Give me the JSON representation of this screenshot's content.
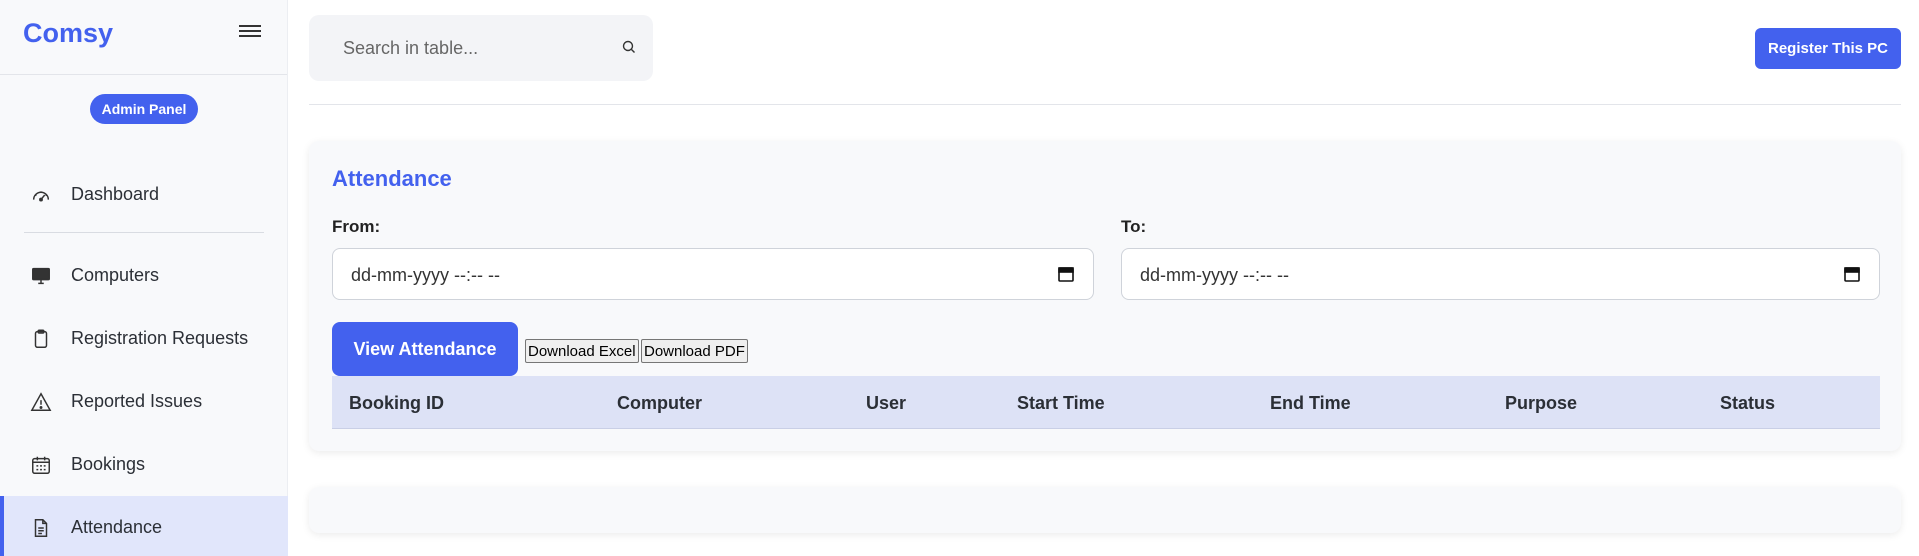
{
  "brand": {
    "title": "Comsy"
  },
  "sidebar": {
    "badge": "Admin Panel",
    "items": [
      {
        "label": "Dashboard",
        "icon": "gauge-icon"
      },
      {
        "label": "Computers",
        "icon": "monitor-icon"
      },
      {
        "label": "Registration Requests",
        "icon": "clipboard-icon"
      },
      {
        "label": "Reported Issues",
        "icon": "warning-triangle-icon"
      },
      {
        "label": "Bookings",
        "icon": "calendar-icon"
      },
      {
        "label": "Attendance",
        "icon": "document-icon",
        "active": true
      }
    ]
  },
  "search": {
    "placeholder": "Search in table..."
  },
  "header": {
    "register_label": "Register This PC"
  },
  "attendance": {
    "title": "Attendance",
    "from_label": "From:",
    "to_label": "To:",
    "from_value": "dd-mm-yyyy --:-- --",
    "to_value": "dd-mm-yyyy --:-- --",
    "view_label": "View Attendance",
    "excel_label": "Download Excel",
    "pdf_label": "Download PDF",
    "columns": [
      "Booking ID",
      "Computer",
      "User",
      "Start Time",
      "End Time",
      "Purpose",
      "Status"
    ]
  },
  "colors": {
    "accent": "#4361ee",
    "active_bg": "#e1e6fb",
    "table_head_bg": "#dde2f6"
  }
}
